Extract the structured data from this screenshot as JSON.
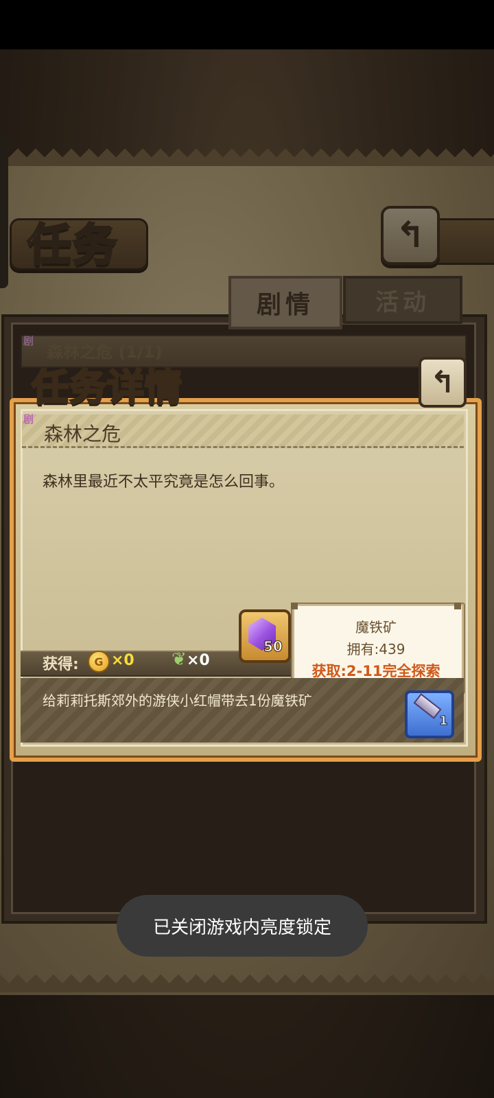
{
  "header": {
    "title": "任务"
  },
  "tabs": [
    {
      "label": "剧情",
      "active": true
    },
    {
      "label": "活动",
      "active": false
    }
  ],
  "quest_list": [
    {
      "badge": "剧",
      "title": "森林之危 (1/1)"
    }
  ],
  "detail": {
    "title": "任务详情",
    "badge": "剧",
    "quest_name": "森林之危",
    "description": "森林里最近不太平究竟是怎么回事。",
    "reward_label": "获得:",
    "coin": {
      "icon": "coin-icon",
      "letter": "G",
      "count": "×0"
    },
    "feather": {
      "icon": "feather-icon",
      "count": "×0"
    },
    "crystal_item": {
      "icon": "purple-crystal-icon",
      "qty": "50"
    },
    "objective": "给莉莉托斯郊外的游侠小红帽带去1份魔铁矿",
    "required_item": {
      "icon": "mithril-ore-icon",
      "qty": "1"
    }
  },
  "tooltip": {
    "name": "魔铁矿",
    "owned": "拥有:439",
    "source": "获取:2-11完全探索"
  },
  "toast": {
    "text": "已关闭游戏内亮度锁定"
  },
  "colors": {
    "accent_orange": "#e4a04a",
    "tooltip_source": "#d0581a",
    "coin_yellow": "#f6de3a"
  }
}
